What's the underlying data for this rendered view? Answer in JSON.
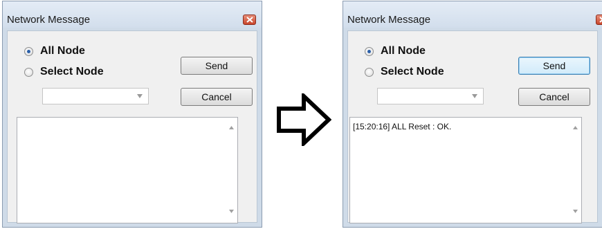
{
  "left_dialog": {
    "title": "Network Message",
    "radio_all_label": "All Node",
    "radio_select_label": "Select Node",
    "send_label": "Send",
    "cancel_label": "Cancel",
    "log_text": ""
  },
  "right_dialog": {
    "title": "Network Message",
    "radio_all_label": "All Node",
    "radio_select_label": "Select Node",
    "send_label": "Send",
    "cancel_label": "Cancel",
    "log_text": "[15:20:16] ALL Reset : OK."
  },
  "colors": {
    "title_bar": "#d2deec",
    "close_button": "#c8452b",
    "radio_dot": "#2a5fa8",
    "focused_button": "#3c7fb1"
  },
  "icons": {
    "transition": "right-arrow-icon",
    "close": "close-icon",
    "dropdown": "chevron-down-icon"
  }
}
